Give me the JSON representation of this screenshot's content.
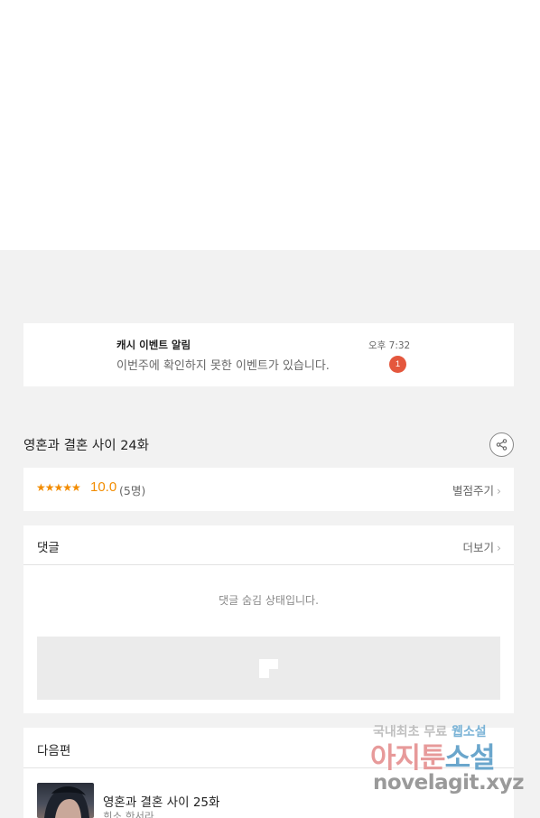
{
  "notification": {
    "title": "캐시 이벤트 알림",
    "message": "이번주에 확인하지 못한 이벤트가 있습니다.",
    "time": "오후 7:32",
    "badge": "1"
  },
  "episode": {
    "title": "영혼과 결혼 사이 24화",
    "share_icon": "share-icon"
  },
  "rating": {
    "stars": "★★★★★",
    "score": "10.0",
    "count": "(5명)",
    "rate_link": "별점주기"
  },
  "comments": {
    "title": "댓글",
    "more": "더보기",
    "hidden_message": "댓글 숨김 상태입니다."
  },
  "next_episode": {
    "section_title": "다음편",
    "title": "영혼과 결혼 사이 25화",
    "author": "희소,한서라"
  },
  "watermark": {
    "line1_a": "국내최초 무료 ",
    "line1_b": "웹소설",
    "main_a": "아지툰",
    "main_b": "소설",
    "url": "novelagit.xyz"
  },
  "colors": {
    "accent": "#f28c00",
    "badge": "#e4573d",
    "background": "#f2f2f2"
  }
}
